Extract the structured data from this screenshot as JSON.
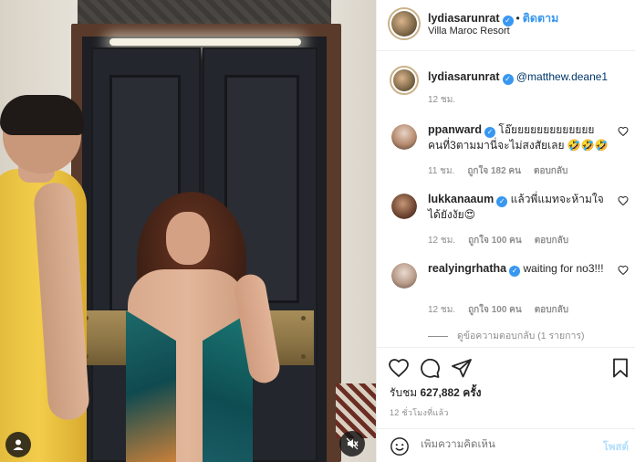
{
  "post": {
    "author": "lydiasarunrat",
    "follow_label": "ติดตาม",
    "location": "Villa Maroc Resort",
    "caption": {
      "author": "lydiasarunrat",
      "mention": "@matthew.deane1",
      "time": "12 ชม."
    }
  },
  "comments": [
    {
      "author": "ppanward",
      "text": "โอ๊ยยยยยยยยยยยยย คนที่3ตามมานี่จะไม่สงสัยเลย 🤣🤣🤣",
      "time": "11 ชม.",
      "likes": "ถูกใจ 182 คน",
      "reply_label": "ตอบกลับ"
    },
    {
      "author": "lukkanaaum",
      "text": "แล้วพี่แมทจะห้ามใจได้ยังงัย😍",
      "time": "12 ชม.",
      "likes": "ถูกใจ 100 คน",
      "reply_label": "ตอบกลับ"
    },
    {
      "author": "realyingrhatha",
      "text": "waiting for no3!!!",
      "time": "12 ชม.",
      "likes": "ถูกใจ 100 คน",
      "reply_label": "ตอบกลับ"
    }
  ],
  "view_replies": "ดูข้อความตอบกลับ (1 รายการ)",
  "stats": {
    "views_prefix": "รับชม",
    "views_count": "627,882",
    "views_suffix": "ครั้ง",
    "time_ago": "12 ชั่วโมงที่แล้ว"
  },
  "composer": {
    "placeholder": "เพิ่มความคิดเห็น",
    "post_label": "โพสต์"
  },
  "colors": {
    "accent": "#3897f0",
    "post_disabled": "#b2dffc",
    "muted": "#8e8e8e"
  },
  "icons": [
    "verified-icon",
    "heart-icon",
    "comment-icon",
    "share-icon",
    "bookmark-icon",
    "emoji-icon",
    "user-tag-icon",
    "mute-icon"
  ]
}
